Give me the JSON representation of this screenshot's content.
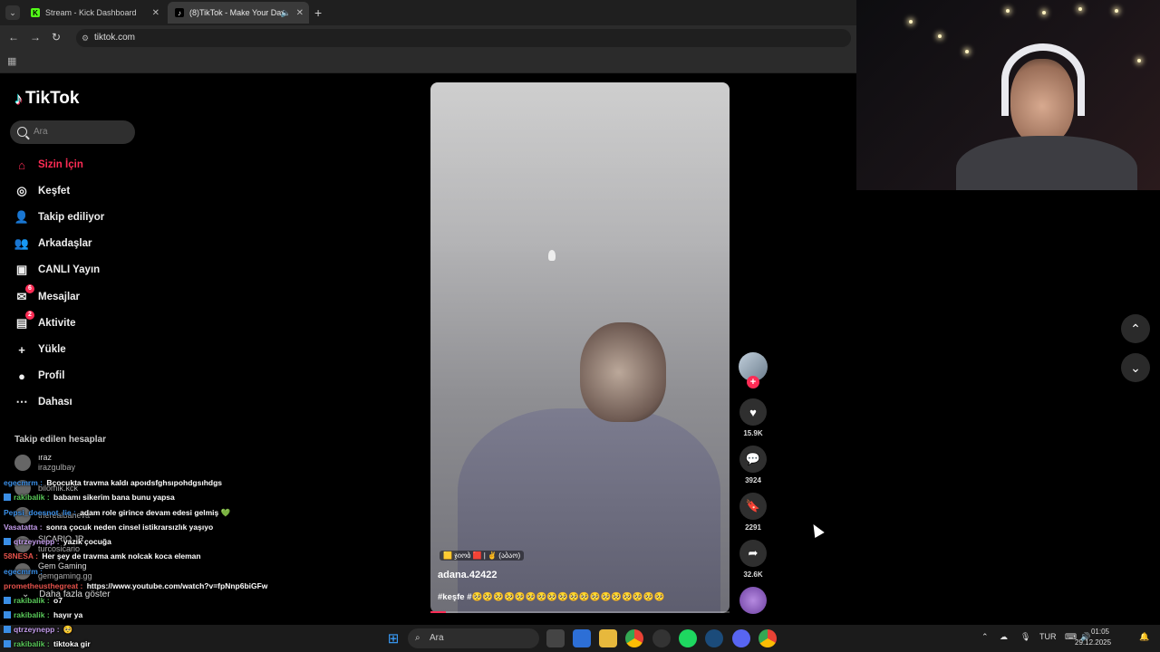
{
  "browser": {
    "tabs": [
      {
        "label": "Stream - Kick Dashboard",
        "favicon": "K"
      },
      {
        "label": "(8)TikTok - Make Your Day",
        "favicon": "♪"
      }
    ],
    "new_tab": "+",
    "url": "tiktok.com"
  },
  "tiktok": {
    "logo": "TikTok",
    "search_placeholder": "Ara",
    "nav": [
      {
        "label": "Sizin İçin",
        "icon": "home-icon",
        "glyph": "⌂"
      },
      {
        "label": "Keşfet",
        "icon": "compass-icon",
        "glyph": "◎"
      },
      {
        "label": "Takip ediliyor",
        "icon": "following-icon",
        "glyph": "👤"
      },
      {
        "label": "Arkadaşlar",
        "icon": "friends-icon",
        "glyph": "👥"
      },
      {
        "label": "CANLI Yayın",
        "icon": "live-icon",
        "glyph": "▣"
      },
      {
        "label": "Mesajlar",
        "icon": "messages-icon",
        "glyph": "✉",
        "badge": "6"
      },
      {
        "label": "Aktivite",
        "icon": "activity-icon",
        "glyph": "▤",
        "badge": "2"
      },
      {
        "label": "Yükle",
        "icon": "upload-icon",
        "glyph": "+"
      },
      {
        "label": "Profil",
        "icon": "profile-icon",
        "glyph": "●"
      },
      {
        "label": "Dahası",
        "icon": "more-icon",
        "glyph": "⋯"
      }
    ],
    "followed_title": "Takip edilen hesaplar",
    "followed": [
      {
        "name": "ıraz",
        "username": "irazgulbay"
      },
      {
        "name": "",
        "username": "bilomik.kck"
      },
      {
        "name": "",
        "username": "therealbaneva"
      },
      {
        "name": "SICARIO JR",
        "username": "turcosicario"
      },
      {
        "name": "Gem Gaming",
        "username": "gemgaming.gg"
      }
    ],
    "see_more": "Daha fazla göster",
    "video": {
      "author": "adana.42422",
      "caption": "#keşfe #🥺🥺🥺🥺🥺🥺🥺🥺🥺🥺🥺🥺🥺🥺🥺🥺🥺🥺",
      "sticker": "🟨 ჯიობ 🟥 | ✌ (აბაო)",
      "progress": 0.05
    },
    "actions": {
      "likes": "15.9K",
      "comments": "3924",
      "saves": "2291",
      "shares": "32.6K"
    }
  },
  "chat": [
    {
      "user": "egecmrm",
      "color": "#3a8ee6",
      "msg": "Bçocukta travma kaldı apoıdsfghsıpohdgsıhdgs",
      "badge": false
    },
    {
      "user": "rakibalik",
      "color": "#59c959",
      "msg": "babamı sikerim bana bunu yapsa",
      "badge": true
    },
    {
      "user": "Pepsi_doesnot_lie",
      "color": "#3a8ee6",
      "msg": "adam role girince devam edesi gelmiş 💚",
      "badge": false
    },
    {
      "user": "Vasatatta",
      "color": "#c59ded",
      "msg": "sonra çocuk neden cinsel istikrarsızlık yaşıyo",
      "badge": false
    },
    {
      "user": "qtrzeynepp",
      "color": "#c59ded",
      "msg": "yazık çocuğa",
      "badge": true
    },
    {
      "user": "58NESA",
      "color": "#e6524b",
      "msg": "Her şey de travma amk nolcak koca eleman",
      "badge": false
    },
    {
      "user": "egecmrm",
      "color": "#3a8ee6",
      "msg": "",
      "badge": false
    },
    {
      "user": "prometheusthegreat",
      "color": "#e6524b",
      "msg": "https://www.youtube.com/watch?v=fpNnp6biGFw",
      "badge": false
    },
    {
      "user": "rakibalik",
      "color": "#59c959",
      "msg": "o7",
      "badge": true
    },
    {
      "user": "rakibalik",
      "color": "#59c959",
      "msg": "hayır ya",
      "badge": true
    },
    {
      "user": "qtrzeynepp",
      "color": "#c59ded",
      "msg": "🥺",
      "badge": true
    },
    {
      "user": "rakibalik",
      "color": "#59c959",
      "msg": "tiktoka gir",
      "badge": true
    }
  ],
  "taskbar": {
    "search_placeholder": "Ara",
    "lang": "TUR",
    "time": "01:05",
    "date": "29.12.2025"
  },
  "colors": {
    "accent": "#fe2c55",
    "chrome_bg": "#1f1f1f"
  }
}
